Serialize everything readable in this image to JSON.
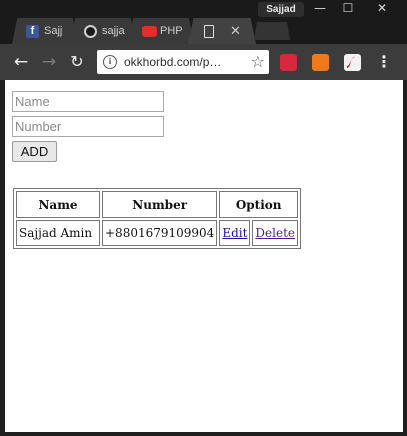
{
  "browser": {
    "profile_name": "Sajjad",
    "window_buttons": {
      "minimize": "—",
      "maximize": "☐",
      "close": "✕"
    },
    "tabs": [
      {
        "label": "Sajj",
        "icon": "facebook-icon",
        "color": "#3b5998"
      },
      {
        "label": "sajja",
        "icon": "github-icon",
        "color": "#ffffff"
      },
      {
        "label": "PHP",
        "icon": "youtube-icon",
        "color": "#e52d27"
      },
      {
        "label": "",
        "icon": "page-icon",
        "active": true,
        "close": "✕"
      }
    ],
    "nav": {
      "back": "←",
      "forward": "→",
      "reload": "↻",
      "menu": "⋮"
    },
    "address": {
      "url": "okkhorbd.com/p…",
      "info": "i",
      "star": "☆"
    },
    "extensions": [
      "red-play-extension-icon",
      "orange-extension-icon",
      "flash-extension-icon"
    ]
  },
  "form": {
    "name_placeholder": "Name",
    "number_placeholder": "Number",
    "add_label": "ADD"
  },
  "table": {
    "headers": {
      "name": "Name",
      "number": "Number",
      "option": "Option"
    },
    "rows": [
      {
        "name": "Sajjad Amin",
        "number": "+8801679109904",
        "edit": "Edit",
        "delete": "Delete"
      }
    ]
  }
}
